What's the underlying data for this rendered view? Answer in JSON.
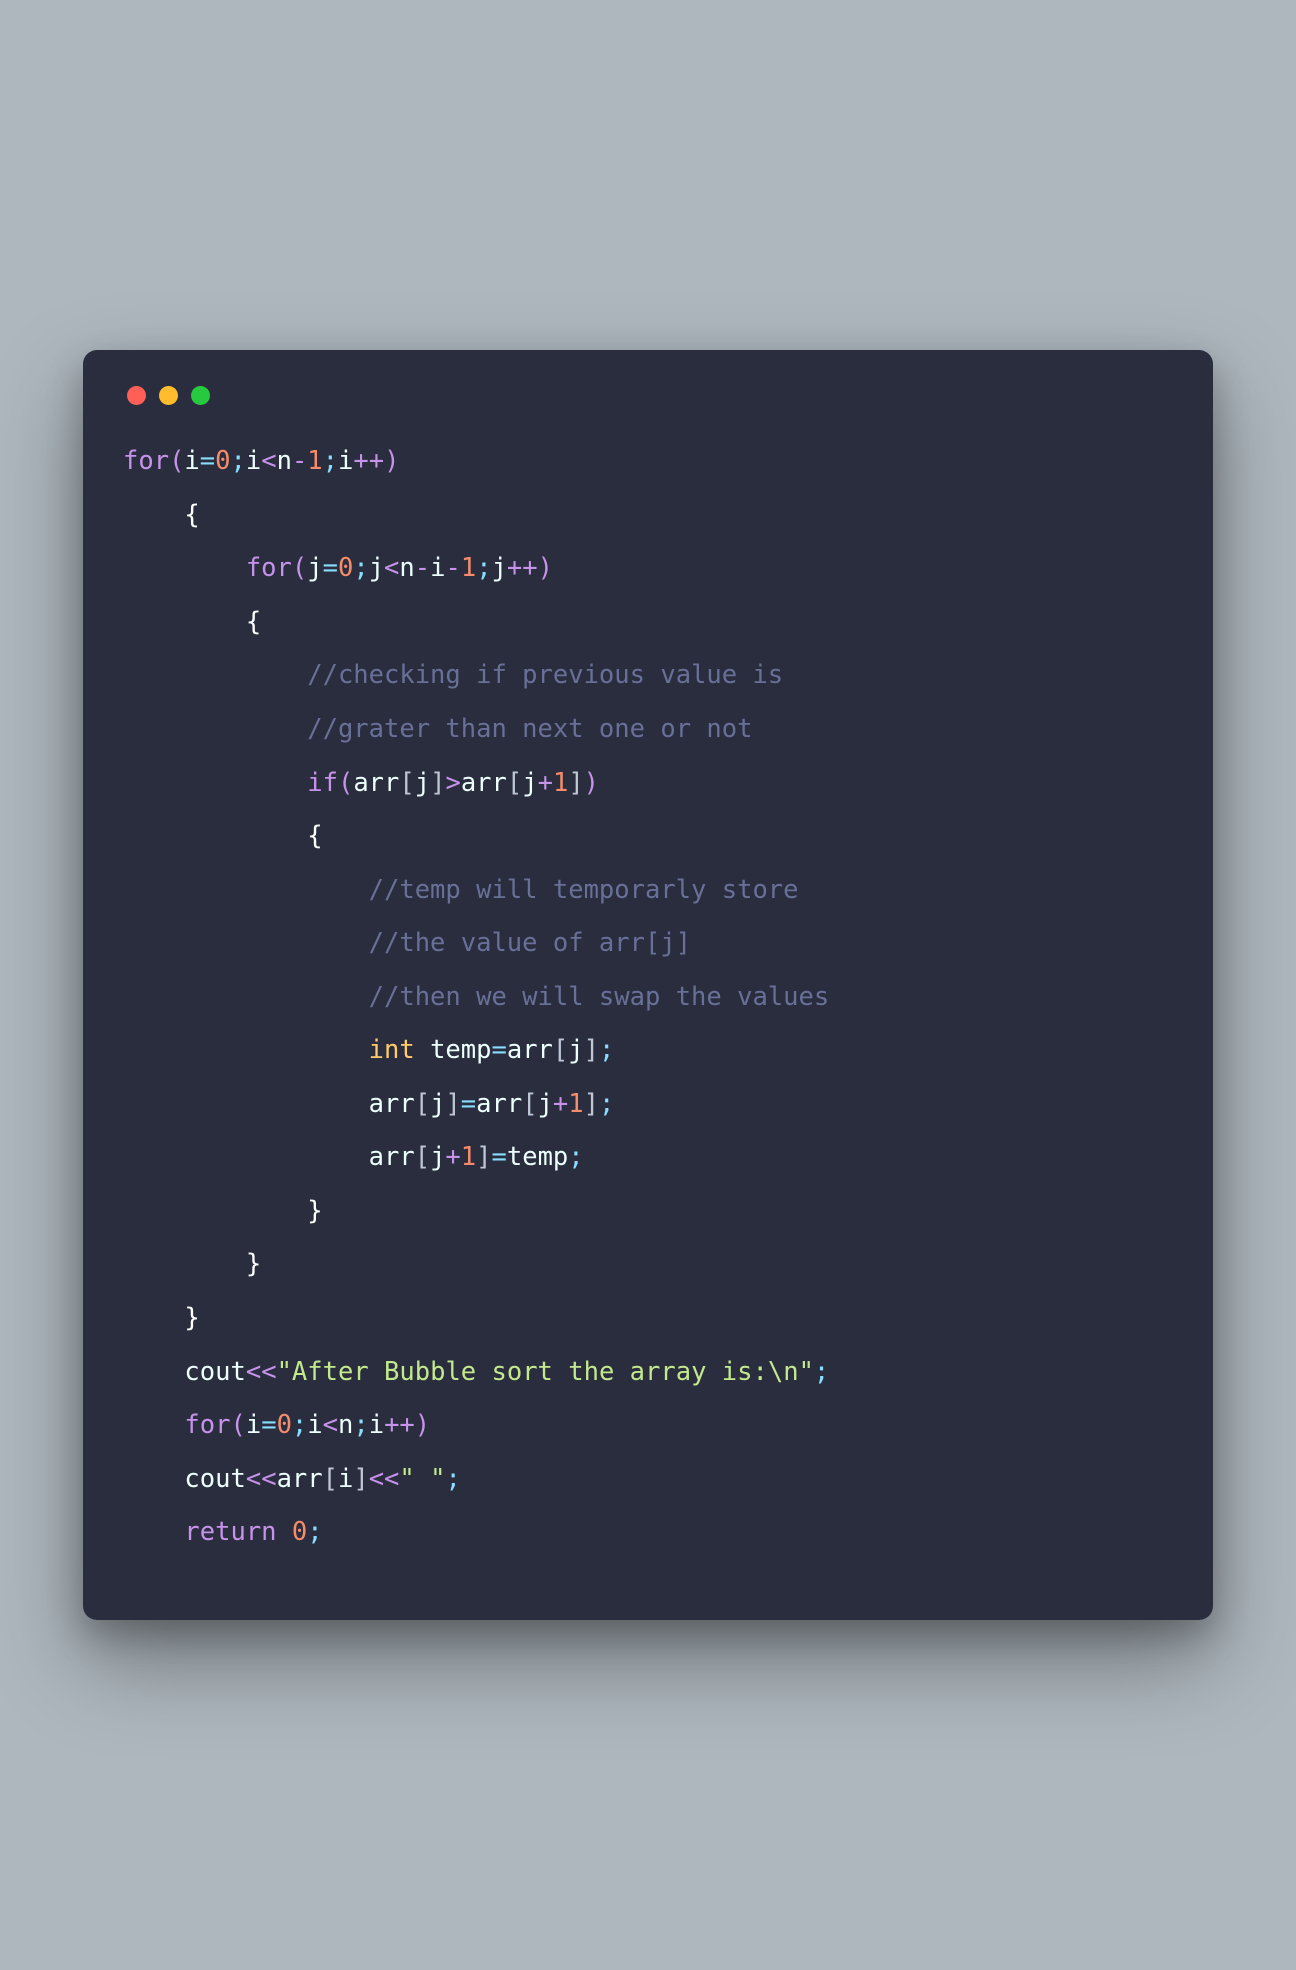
{
  "colors": {
    "background_page": "#aeb7be",
    "background_editor": "#292d3e",
    "dot_red": "#ff5f56",
    "dot_yellow": "#ffbd2e",
    "dot_green": "#27c93f",
    "keyword": "#c792ea",
    "type": "#ffcb6b",
    "identifier": "#eeffff",
    "operator": "#89ddff",
    "number": "#f78c6c",
    "string": "#c3e88d",
    "comment": "#697098"
  },
  "code": {
    "kw_for": "for",
    "kw_if": "if",
    "kw_return": "return",
    "kw_int": "int",
    "id_i": "i",
    "id_j": "j",
    "id_n": "n",
    "id_arr": "arr",
    "id_temp": "temp",
    "id_cout": "cout",
    "num_0": "0",
    "num_1": "1",
    "cmt1": "//checking if previous value is",
    "cmt2": "//grater than next one or not",
    "cmt3": "//temp will temporarly store",
    "cmt4": "//the value of arr[j]",
    "cmt5": "//then we will swap the values",
    "str1": "\"After Bubble sort the array is:",
    "esc1": "\\n",
    "str1_end": "\"",
    "str2": "\" \"",
    "lparen": "(",
    "rparen": ")",
    "lbrace": "{",
    "rbrace": "}",
    "lbracket": "[",
    "rbracket": "]",
    "semi": ";",
    "eq": "=",
    "lt": "<",
    "gt": ">",
    "minus": "-",
    "plus": "+",
    "ltlt": "<<",
    "inc": "++"
  }
}
